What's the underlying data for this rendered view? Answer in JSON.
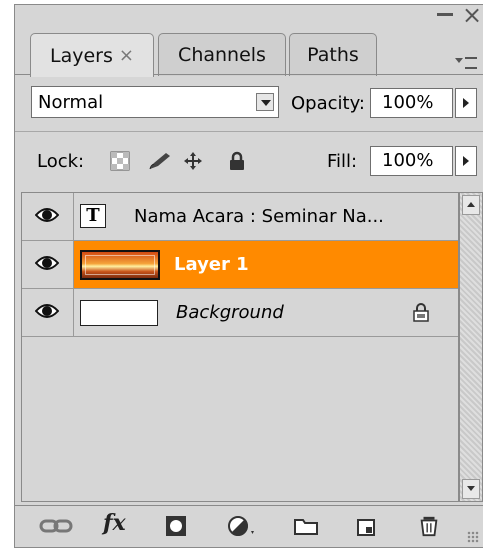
{
  "tabs": [
    {
      "label": "Layers",
      "close": "×",
      "active": true
    },
    {
      "label": "Channels",
      "active": false
    },
    {
      "label": "Paths",
      "active": false
    }
  ],
  "window": {
    "minimize_icon": "minimize-icon",
    "close_icon": "close-icon",
    "menu_icon": "panel-menu-icon"
  },
  "blend_mode": {
    "value": "Normal"
  },
  "opacity": {
    "label": "Opacity:",
    "value": "100%"
  },
  "lock": {
    "label": "Lock:",
    "icons": [
      "lock-transparent-icon",
      "lock-image-icon",
      "lock-position-icon",
      "lock-all-icon"
    ]
  },
  "fill": {
    "label": "Fill:",
    "value": "100%"
  },
  "layers": [
    {
      "name": "Nama Acara  : Seminar Na...",
      "thumb": "T",
      "type": "text",
      "visible": true,
      "selected": false
    },
    {
      "name": "Layer 1",
      "type": "image",
      "visible": true,
      "selected": true
    },
    {
      "name": "Background",
      "type": "background",
      "visible": true,
      "selected": false,
      "locked": true
    }
  ],
  "toolbar": [
    "link-layers-icon",
    "fx-icon",
    "add-mask-icon",
    "adjustment-layer-icon",
    "new-group-icon",
    "new-layer-icon",
    "delete-icon"
  ],
  "toolbar_fx": "fx",
  "colors": {
    "selected": "#ff8a00",
    "panel": "#d6d6d6"
  }
}
